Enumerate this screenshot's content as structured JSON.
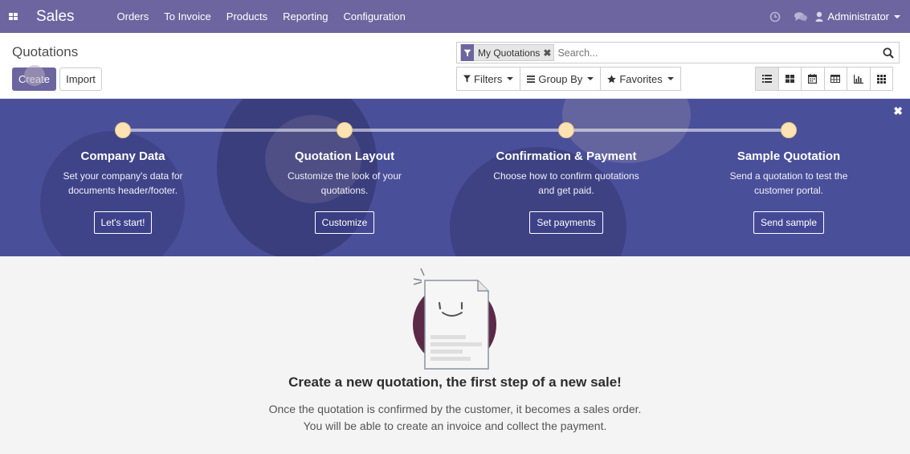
{
  "navbar": {
    "app_name": "Sales",
    "menu": [
      "Orders",
      "To Invoice",
      "Products",
      "Reporting",
      "Configuration"
    ],
    "user": "Administrator",
    "icons": [
      "apps-grid-icon",
      "clock-icon",
      "chat-icon",
      "user-icon"
    ],
    "color": "#6c659f"
  },
  "control_panel": {
    "breadcrumb": "Quotations",
    "create_label": "Create",
    "import_label": "Import",
    "search": {
      "facet_label": "My Quotations",
      "placeholder": "Search..."
    },
    "filters_label": "Filters",
    "groupby_label": "Group By",
    "favorites_label": "Favorites",
    "views": [
      "list",
      "kanban",
      "calendar",
      "pivot",
      "graph",
      "grid"
    ],
    "active_view": "list"
  },
  "onboarding": {
    "steps": [
      {
        "title": "Company Data",
        "desc1": "Set your company's data for",
        "desc2": "documents header/footer.",
        "button": "Let's start!"
      },
      {
        "title": "Quotation Layout",
        "desc1": "Customize the look of your",
        "desc2": "quotations.",
        "button": "Customize"
      },
      {
        "title": "Confirmation & Payment",
        "desc1": "Choose how to confirm quotations",
        "desc2": "and get paid.",
        "button": "Set payments"
      },
      {
        "title": "Sample Quotation",
        "desc1": "Send a quotation to test the",
        "desc2": "customer portal.",
        "button": "Send sample"
      }
    ],
    "dot_color": "#fbe3b3",
    "background": "#4a4f9a"
  },
  "help": {
    "title": "Create a new quotation, the first step of a new sale!",
    "line1": "Once the quotation is confirmed by the customer, it becomes a sales order.",
    "line2": "You will be able to create an invoice and collect the payment."
  }
}
